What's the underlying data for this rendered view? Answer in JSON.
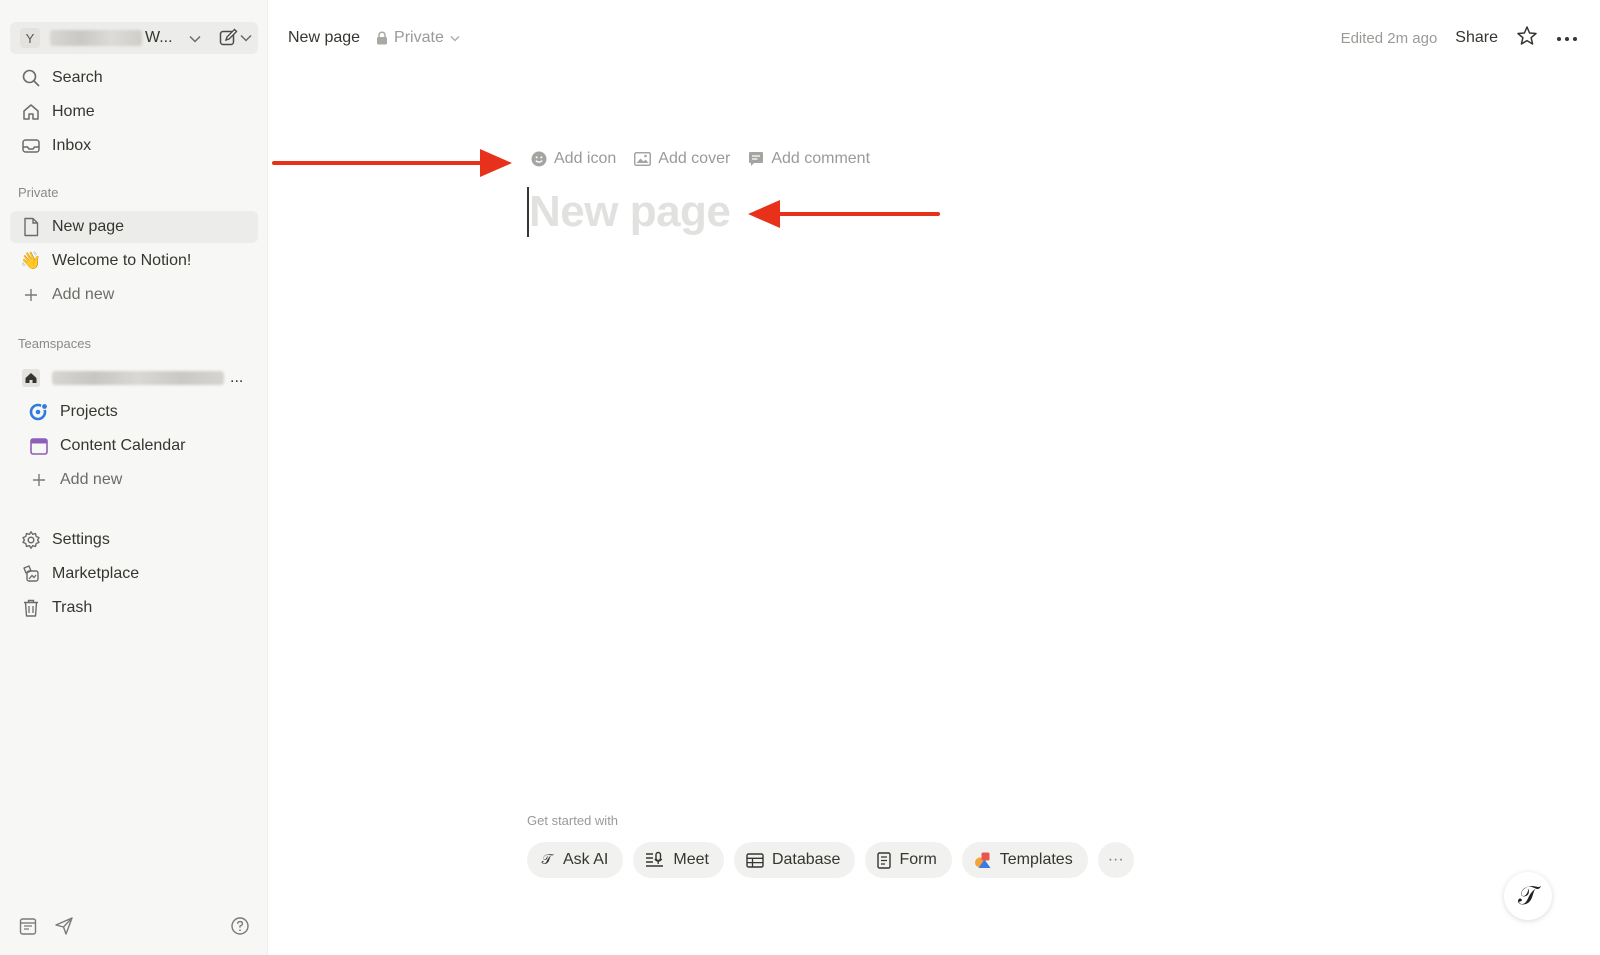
{
  "workspace": {
    "avatar_letter": "Y",
    "name_suffix": "W...",
    "chevron": "⌄"
  },
  "sidebar": {
    "top_items": [
      {
        "label": "Search",
        "icon": "search-icon"
      },
      {
        "label": "Home",
        "icon": "home-icon"
      },
      {
        "label": "Inbox",
        "icon": "inbox-icon"
      }
    ],
    "private_label": "Private",
    "private_items": [
      {
        "label": "New page",
        "icon": "page-icon",
        "active": true
      },
      {
        "label": "Welcome to Notion!",
        "icon": "waving-hand-icon",
        "emoji": "👋"
      },
      {
        "label": "Add new",
        "icon": "plus-icon"
      }
    ],
    "teamspaces_label": "Teamspaces",
    "teamspace_ellipsis": "...",
    "teamspace_items": [
      {
        "label": "Projects",
        "icon": "projects-icon"
      },
      {
        "label": "Content Calendar",
        "icon": "calendar-icon"
      },
      {
        "label": "Add new",
        "icon": "plus-icon"
      }
    ],
    "bottom_items": [
      {
        "label": "Settings",
        "icon": "gear-icon"
      },
      {
        "label": "Marketplace",
        "icon": "marketplace-icon"
      },
      {
        "label": "Trash",
        "icon": "trash-icon"
      }
    ]
  },
  "topbar": {
    "breadcrumb": "New page",
    "privacy": "Private",
    "edited": "Edited 2m ago",
    "share": "Share",
    "more": "···"
  },
  "page": {
    "actions": {
      "add_icon": "Add icon",
      "add_cover": "Add cover",
      "add_comment": "Add comment"
    },
    "title_placeholder": "New page"
  },
  "get_started": {
    "label": "Get started with",
    "chips": [
      {
        "label": "Ask AI",
        "icon": "ai-icon"
      },
      {
        "label": "Meet",
        "icon": "meet-icon"
      },
      {
        "label": "Database",
        "icon": "table-icon"
      },
      {
        "label": "Form",
        "icon": "form-icon"
      },
      {
        "label": "Templates",
        "icon": "templates-icon"
      }
    ],
    "more": "···"
  },
  "colors": {
    "arrow": "#e8311a",
    "sidebar_bg": "#f7f7f5",
    "placeholder": "#e1e1df",
    "accent_purple": "#8e5fb8",
    "accent_blue": "#2f7be0"
  },
  "ai_fab_glyph": "𝒯"
}
